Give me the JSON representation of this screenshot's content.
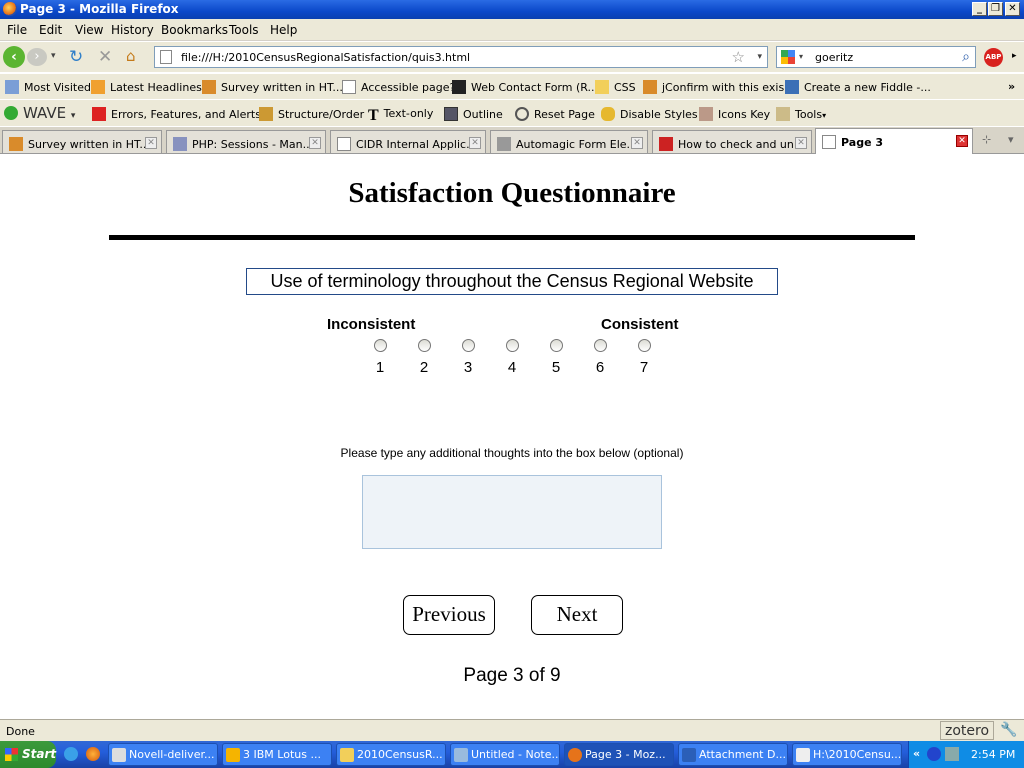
{
  "window": {
    "title": "Page 3 - Mozilla Firefox"
  },
  "menu": [
    "File",
    "Edit",
    "View",
    "History",
    "Bookmarks",
    "Tools",
    "Help"
  ],
  "nav": {
    "url": "file:///H:/2010CensusRegionalSatisfaction/quis3.html",
    "search_value": "goeritz",
    "adblock_label": "ABP"
  },
  "bookmarks": [
    "Most Visited",
    "Latest Headlines",
    "Survey written in HT...",
    "Accessible page?",
    "Web Contact Form (R...",
    "CSS",
    "jConfirm with this exis...",
    "Create a new Fiddle -..."
  ],
  "wave_toolbar": {
    "wave_label": "WAVE",
    "items": [
      "Errors, Features, and Alerts",
      "Structure/Order",
      "Text-only",
      "Outline",
      "Reset Page",
      "Disable Styles",
      "Icons Key",
      "Tools"
    ]
  },
  "tabs": [
    "Survey written in HT...",
    "PHP: Sessions - Man...",
    "CIDR Internal Applic...",
    "Automagic Form Ele...",
    "How to check and un...",
    "Page 3"
  ],
  "page": {
    "heading": "Satisfaction Questionnaire",
    "question": "Use of terminology throughout the Census Regional Website",
    "scale_low_label": "Inconsistent",
    "scale_high_label": "Consistent",
    "scale_values": [
      "1",
      "2",
      "3",
      "4",
      "5",
      "6",
      "7"
    ],
    "comment_prompt": "Please type any additional thoughts into the box below (optional)",
    "comment_value": "",
    "previous_label": "Previous",
    "next_label": "Next",
    "page_indicator": "Page 3 of 9"
  },
  "status": {
    "text": "Done",
    "zotero": "zotero"
  },
  "taskbar": {
    "start_label": "Start",
    "items": [
      "Novell-deliver...",
      "3 IBM Lotus ...",
      "2010CensusR...",
      "Untitled - Note...",
      "Page 3 - Moz...",
      "Attachment D...",
      "H:\\2010Censu..."
    ],
    "clock": "2:54 PM"
  },
  "colors": {
    "titlebar": "#0b48c9",
    "chrome": "#ece9d8",
    "taskbar": "#245edb",
    "start": "#2d8a2d",
    "question_border": "#234a88",
    "textarea_bg": "#eef3f8"
  }
}
